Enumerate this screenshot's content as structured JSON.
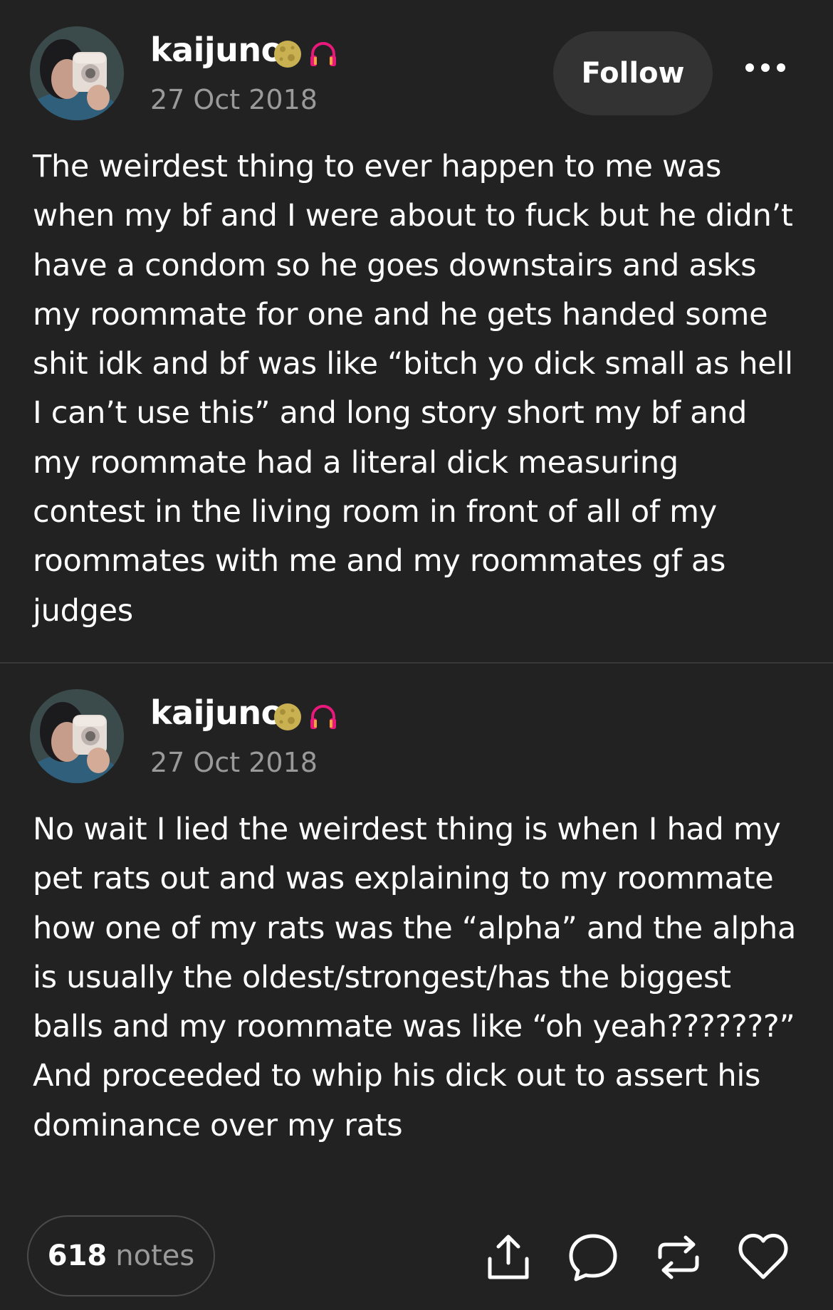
{
  "posts": [
    {
      "username": "kaijuno",
      "date": "27 Oct 2018",
      "follow_label": "Follow",
      "text": "The weirdest thing to ever happen to me was\nwhen my bf and I were about to fuck but he didn’t\nhave a condom so he goes downstairs and asks\nmy roommate for one and he gets handed some\nshit idk and bf was like “bitch yo dick small as hell\nI can’t use this” and long story short my bf and\nmy roommate had a literal dick measuring\ncontest in the living room in front of all of my\nroommates with me and my roommates gf as\njudges"
    },
    {
      "username": "kaijuno",
      "date": "27 Oct 2018",
      "text": "No wait I lied the weirdest thing is when I had my\npet rats out and was explaining to my roommate\nhow one of my rats was the “alpha” and the alpha\nis usually the oldest/strongest/has the biggest\nballs and my roommate was like “oh yeah???????”\nAnd proceeded to whip his dick out to assert his\ndominance over my rats"
    }
  ],
  "footer": {
    "notes_count": "618",
    "notes_label": "notes"
  },
  "icons": {
    "badge_1": "moon-icon",
    "badge_2": "headphones-icon",
    "menu": "more-options-icon",
    "actions": [
      "share-icon",
      "reply-icon",
      "reblog-icon",
      "like-icon"
    ]
  },
  "colors": {
    "background": "#222222",
    "text": "#ffffff",
    "muted": "#9a9a9a",
    "button": "#333333",
    "headphones": "#e8197a",
    "moon": "#c9b152"
  }
}
